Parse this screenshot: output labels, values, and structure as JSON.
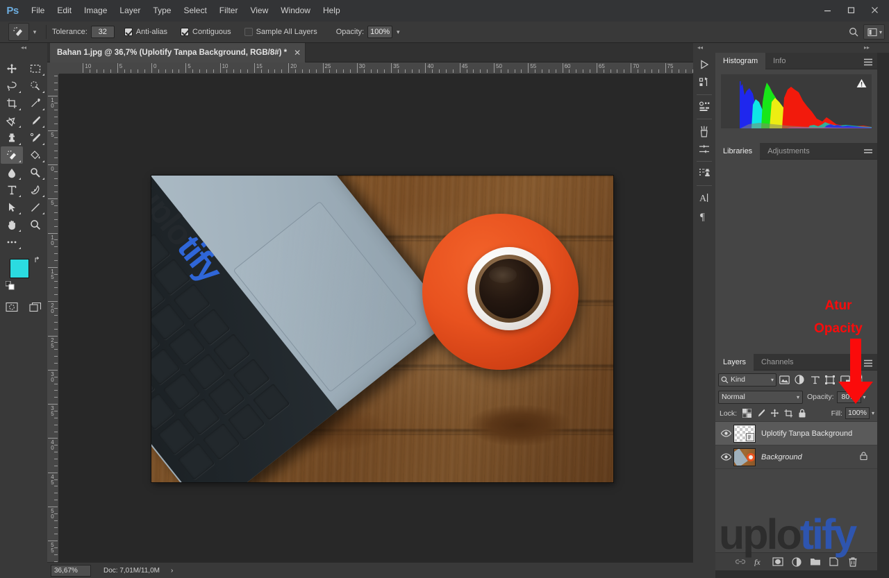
{
  "app": {
    "logo": "Ps"
  },
  "menubar": {
    "items": [
      "File",
      "Edit",
      "Image",
      "Layer",
      "Type",
      "Select",
      "Filter",
      "View",
      "Window",
      "Help"
    ]
  },
  "window_controls": {
    "minimize": "minimize-icon",
    "maximize": "maximize-icon",
    "close": "close-icon"
  },
  "options_bar": {
    "tool_icon": "magic-eraser-icon",
    "tolerance_label": "Tolerance:",
    "tolerance_value": "32",
    "antialias_label": "Anti-alias",
    "antialias_checked": true,
    "contiguous_label": "Contiguous",
    "contiguous_checked": true,
    "sample_all_layers_label": "Sample All Layers",
    "sample_all_layers_checked": false,
    "opacity_label": "Opacity:",
    "opacity_value": "100%",
    "search_icon": "search-icon",
    "workspace_icon": "workspace-switcher-icon"
  },
  "toolbar": {
    "tools": [
      {
        "name": "move-tool",
        "active": false
      },
      {
        "name": "rectangular-marquee-tool",
        "active": false
      },
      {
        "name": "lasso-tool",
        "active": false
      },
      {
        "name": "quick-selection-tool",
        "active": false
      },
      {
        "name": "crop-tool",
        "active": false
      },
      {
        "name": "eyedropper-tool",
        "active": false
      },
      {
        "name": "spot-healing-brush-tool",
        "active": false
      },
      {
        "name": "brush-tool",
        "active": false
      },
      {
        "name": "clone-stamp-tool",
        "active": false
      },
      {
        "name": "history-brush-tool",
        "active": false
      },
      {
        "name": "magic-eraser-tool",
        "active": true
      },
      {
        "name": "paint-bucket-tool",
        "active": false
      },
      {
        "name": "blur-tool",
        "active": false
      },
      {
        "name": "dodge-tool",
        "active": false
      },
      {
        "name": "horizontal-type-tool",
        "active": false
      },
      {
        "name": "pen-tool",
        "active": false
      },
      {
        "name": "path-selection-tool",
        "active": false
      },
      {
        "name": "line-tool",
        "active": false
      },
      {
        "name": "hand-tool",
        "active": false
      },
      {
        "name": "zoom-tool",
        "active": false
      },
      {
        "name": "edit-toolbar-tool",
        "active": false
      }
    ],
    "foreground_color": "#2bdbe0",
    "background_color": "#ffffff",
    "swap_colors_icon": "swap-colors-icon",
    "default_colors_icon": "default-colors-icon",
    "quick_mask_icon": "quick-mask-icon",
    "screen_mode_icon": "screen-mode-icon"
  },
  "document_tab": {
    "title": "Bahan 1.jpg @ 36,7% (Uplotify Tanpa Background, RGB/8#) *",
    "close_icon": "close-icon"
  },
  "rulers": {
    "horizontal_labels": [
      "10",
      "5",
      "0",
      "5",
      "10",
      "15",
      "20",
      "25",
      "30",
      "35",
      "40",
      "45",
      "50",
      "55",
      "60",
      "65",
      "70",
      "75"
    ],
    "vertical_labels": [
      "10",
      "5",
      "0",
      "5",
      "10",
      "15",
      "20",
      "25",
      "30",
      "35",
      "40",
      "45",
      "50",
      "55"
    ]
  },
  "canvas": {
    "laptop_logo_dark": "uplo",
    "laptop_logo_blue": "tify"
  },
  "status_bar": {
    "zoom": "36,67%",
    "doc_info": "Doc: 7,01M/11,0M",
    "arrow": "›"
  },
  "icon_dock": {
    "icons": [
      "play-icon",
      "history-icon",
      "properties-icon",
      "brushes-icon",
      "brush-settings-icon",
      "clone-source-icon",
      "character-icon",
      "paragraph-icon"
    ]
  },
  "histogram_panel": {
    "tabs": [
      {
        "label": "Histogram",
        "active": true
      },
      {
        "label": "Info",
        "active": false
      }
    ],
    "menu_icon": "panel-menu-icon",
    "warning_icon": "histogram-warning-icon"
  },
  "libraries_panel": {
    "tabs": [
      {
        "label": "Libraries",
        "active": true
      },
      {
        "label": "Adjustments",
        "active": false
      }
    ],
    "menu_icon": "panel-menu-icon"
  },
  "layers_panel": {
    "tabs": [
      {
        "label": "Layers",
        "active": true
      },
      {
        "label": "Channels",
        "active": false
      }
    ],
    "menu_icon": "panel-menu-icon",
    "filter_kind": "Kind",
    "filter_search_icon": "search-icon",
    "filter_icons": [
      "filter-pixel-icon",
      "filter-adjustment-icon",
      "filter-type-icon",
      "filter-shape-icon",
      "filter-smart-object-icon"
    ],
    "blend_mode": "Normal",
    "opacity_label": "Opacity:",
    "opacity_value": "80%",
    "lock_label": "Lock:",
    "lock_icons": [
      "lock-transparent-pixels-icon",
      "lock-image-pixels-icon",
      "lock-position-icon",
      "lock-artboard-icon",
      "lock-all-icon"
    ],
    "fill_label": "Fill:",
    "fill_value": "100%",
    "layers": [
      {
        "name": "Uplotify Tanpa Background",
        "selected": true,
        "visible": true,
        "locked": false,
        "thumb": "transparent-checker"
      },
      {
        "name": "Background",
        "selected": false,
        "visible": true,
        "locked": true,
        "thumb": "photo"
      }
    ],
    "bottom_icons": [
      "link-layers-icon",
      "layer-style-icon",
      "add-mask-icon",
      "adjustment-layer-icon",
      "new-group-icon",
      "new-layer-icon",
      "delete-layer-icon"
    ]
  },
  "annotation": {
    "line1": "Atur",
    "line2": "Opacity",
    "color": "#fb0b0b",
    "arrow_icon": "down-arrow-annotation"
  },
  "watermark": {
    "dark_part": "uplo",
    "blue_part": "tify",
    "dark_color": "#2b2b2b",
    "blue_color": "#2d57b8"
  }
}
